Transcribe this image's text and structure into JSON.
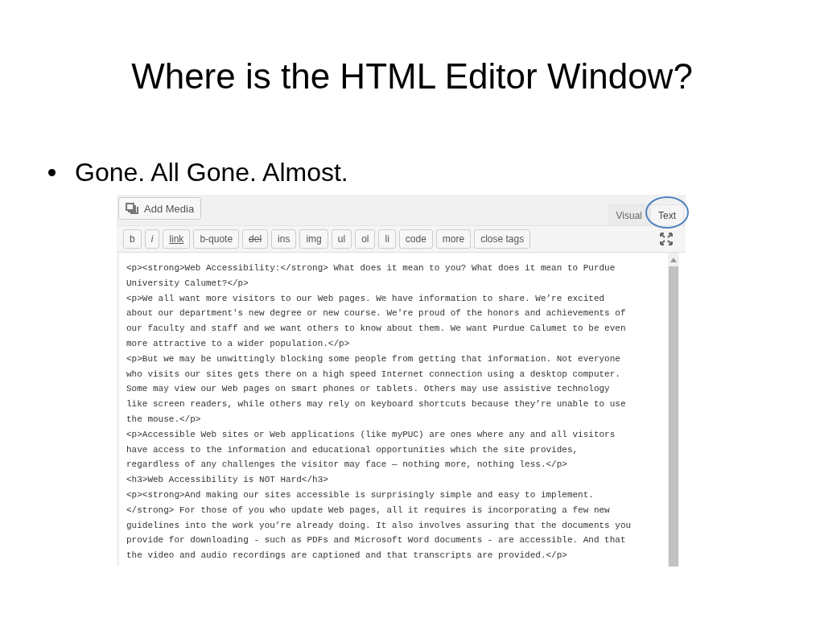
{
  "slide": {
    "title": "Where is the HTML Editor Window?",
    "bullets": [
      "Gone. All Gone. Almost."
    ]
  },
  "editor": {
    "add_media": "Add Media",
    "tabs": [
      {
        "label": "Visual",
        "selected": false,
        "circled": false
      },
      {
        "label": "Text",
        "selected": true,
        "circled": true
      }
    ],
    "quicktags": [
      {
        "label": "b",
        "kind": "plain"
      },
      {
        "label": "i",
        "kind": "italic"
      },
      {
        "label": "link",
        "kind": "underline"
      },
      {
        "label": "b-quote",
        "kind": "plain"
      },
      {
        "label": "del",
        "kind": "strike"
      },
      {
        "label": "ins",
        "kind": "plain"
      },
      {
        "label": "img",
        "kind": "plain"
      },
      {
        "label": "ul",
        "kind": "plain"
      },
      {
        "label": "ol",
        "kind": "plain"
      },
      {
        "label": "li",
        "kind": "plain"
      },
      {
        "label": "code",
        "kind": "plain"
      },
      {
        "label": "more",
        "kind": "plain"
      },
      {
        "label": "close tags",
        "kind": "plain"
      }
    ],
    "lines": [
      "<p><strong>Web Accessibility:</strong> What does it mean to you? What does it mean to Purdue",
      "University Calumet?</p>",
      "<p>We all want more visitors to our Web pages. We have information to share. We’re excited",
      "about our department's new degree or new course. We're proud of the honors and achievements of",
      "our faculty and staff and we want others to know about them. We want Purdue Calumet to be even",
      "more attractive to a wider population.</p>",
      "<p>But we may be unwittingly blocking some people from getting that information. Not everyone",
      "who visits our sites gets there on a high speed Internet connection using a desktop computer.",
      "Some may view our Web pages on smart phones or tablets. Others may use assistive technology",
      "like screen readers, while others may rely on keyboard shortcuts because they’re unable to use",
      "the mouse.</p>",
      "<p>Accessible Web sites or Web applications (like myPUC) are ones where any and all visitors",
      "have access to the information and educational opportunities which the site provides,",
      "regardless of any challenges the visitor may face — nothing more, nothing less.</p>",
      "<h3>Web Accessibility is NOT Hard</h3>",
      "<p><strong>And making our sites accessible is surprisingly simple and easy to implement.",
      "</strong> For those of you who update Web pages, all it requires is incorporating a few new",
      "guidelines into the work you’re already doing. It also involves assuring that the documents you",
      "provide for downloading - such as PDFs and Microsoft Word documents - are accessible. And that",
      "the video and audio recordings are captioned and that transcripts are provided.</p>"
    ]
  }
}
